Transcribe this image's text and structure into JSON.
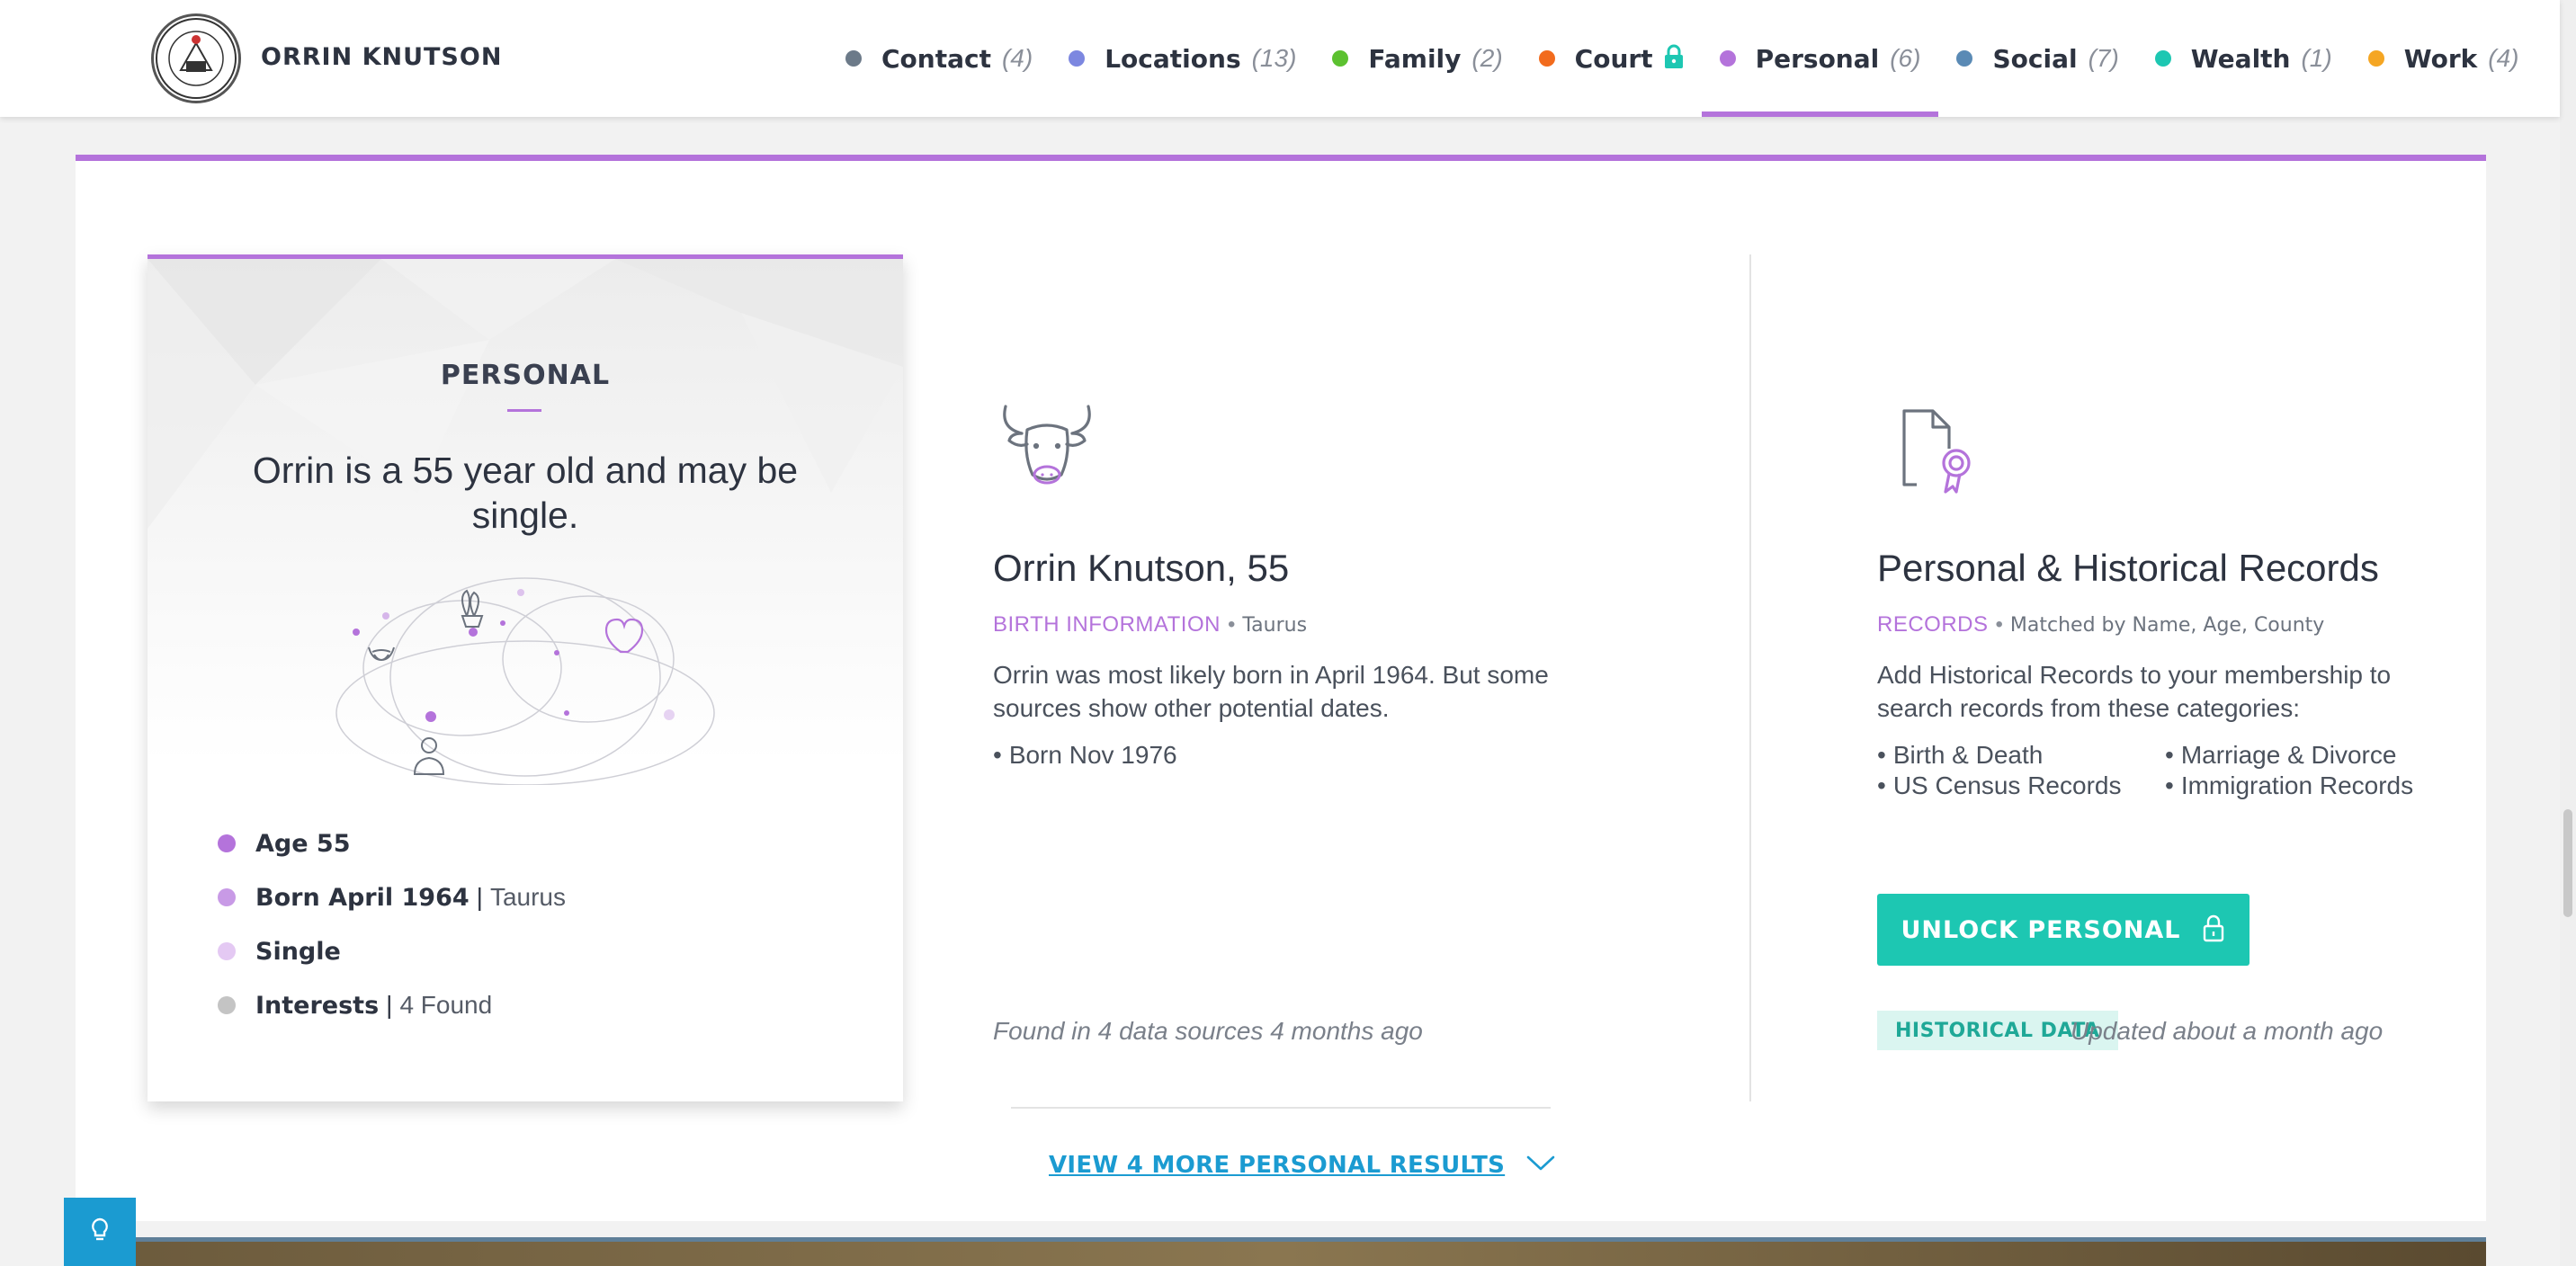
{
  "header": {
    "name": "ORRIN KNUTSON",
    "tabs": [
      {
        "label": "Contact",
        "count": "(4)",
        "color": "#6c7a89"
      },
      {
        "label": "Locations",
        "count": "(13)",
        "color": "#7c87e0"
      },
      {
        "label": "Family",
        "count": "(2)",
        "color": "#5cc130"
      },
      {
        "label": "Court",
        "count": "",
        "color": "#f26b1d",
        "locked": true
      },
      {
        "label": "Personal",
        "count": "(6)",
        "color": "#b473db",
        "active": true
      },
      {
        "label": "Social",
        "count": "(7)",
        "color": "#5a8ab5"
      },
      {
        "label": "Wealth",
        "count": "(1)",
        "color": "#1dc7b2"
      },
      {
        "label": "Work",
        "count": "(4)",
        "color": "#f5a623"
      }
    ]
  },
  "summary_panel": {
    "title": "PERSONAL",
    "summary": "Orrin is a 55 year old and may be single.",
    "facts": [
      {
        "strong": "Age 55",
        "extra": "",
        "color": "#b473db"
      },
      {
        "strong": "Born April 1964",
        "extra": "Taurus",
        "color": "#c89ae6"
      },
      {
        "strong": "Single",
        "extra": "",
        "color": "#e4c9f3"
      },
      {
        "strong": "Interests",
        "extra": "4 Found",
        "color": "#c4c4c4"
      }
    ]
  },
  "birth": {
    "heading": "Orrin Knutson, 55",
    "tag": "BIRTH INFORMATION",
    "tag_detail": "Taurus",
    "description": "Orrin was most likely born in April 1964. But some sources show other potential dates.",
    "alternates": [
      "Born Nov 1976"
    ],
    "found_note": "Found in 4 data sources 4 months ago",
    "icon": "taurus-bull-icon"
  },
  "records": {
    "heading": "Personal & Historical Records",
    "tag": "RECORDS",
    "tag_detail": "Matched by Name, Age, County",
    "description": "Add Historical Records to your membership to search records from these categories:",
    "categories": [
      "Birth & Death",
      "Marriage & Divorce",
      "US Census Records",
      "Immigration Records"
    ],
    "unlock_label": "UNLOCK PERSONAL",
    "badge": "HISTORICAL DATA",
    "updated_note": "Updated about a month ago",
    "icon": "certificate-document-icon"
  },
  "more_results": "VIEW 4 MORE PERSONAL RESULTS",
  "help_icon": "lightbulb-icon"
}
